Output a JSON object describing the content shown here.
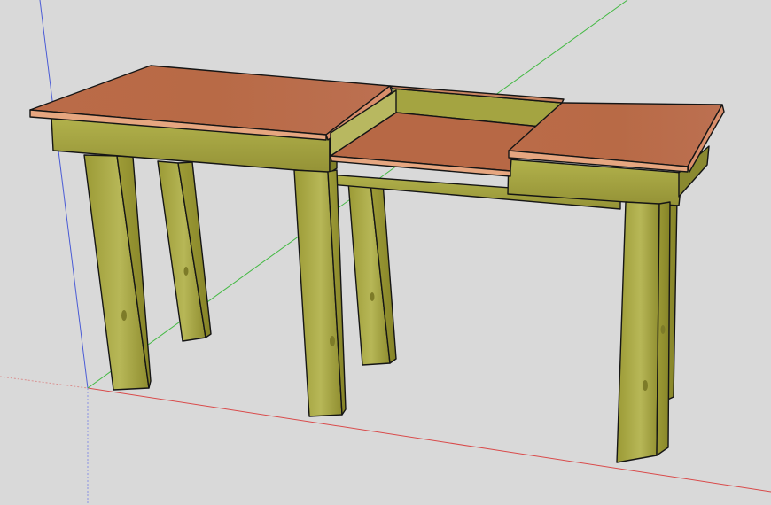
{
  "scene": {
    "background": "#d9d9d9",
    "subject": "wooden-workbench",
    "colors": {
      "top_surface": "#b86a45",
      "top_edge": "#e7a884",
      "wood_frame": "#a8a64a",
      "wood_frame_dark": "#7f7e28",
      "wood_frame_light": "#bfbf62",
      "axis_red": "#d94a4a",
      "axis_green": "#43b943",
      "axis_blue": "#4a5bd6",
      "outline": "#151515"
    },
    "axes": {
      "red": "x-axis",
      "green": "y-axis",
      "blue": "z-axis"
    }
  }
}
